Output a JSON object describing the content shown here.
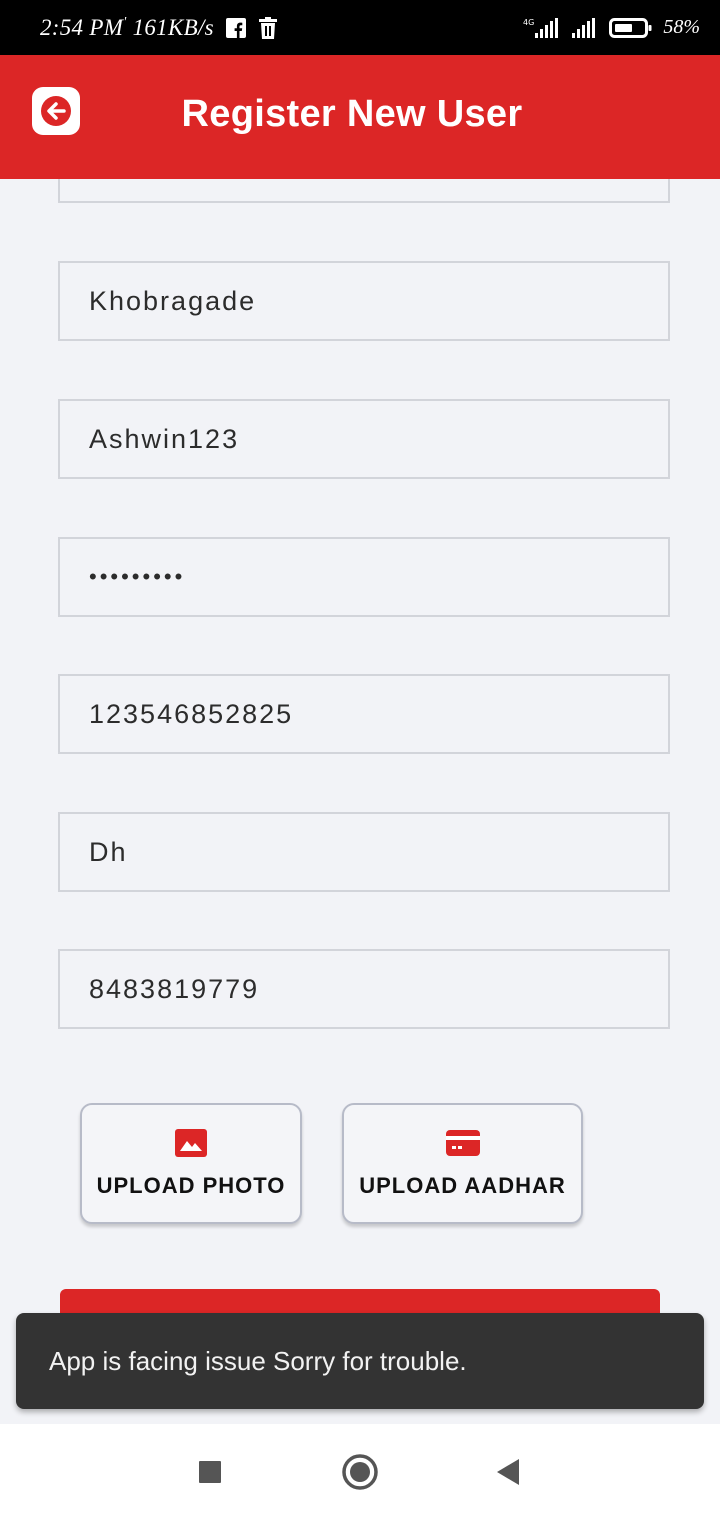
{
  "status_bar": {
    "time": "2:54 PM",
    "network_speed": "161KB/s",
    "network_type": "4G",
    "battery": "58%",
    "icons": [
      "facebook-icon",
      "delete-icon",
      "signal-icon",
      "battery-icon"
    ]
  },
  "app_bar": {
    "title": "Register New User",
    "back_icon": "arrow-left-icon",
    "color": "#dc2626"
  },
  "form": {
    "fields": [
      {
        "value": ""
      },
      {
        "value": "Khobragade"
      },
      {
        "value": "Ashwin123"
      },
      {
        "value": "•••••••••",
        "type": "password"
      },
      {
        "value": "123546852825"
      },
      {
        "value": "Dh"
      },
      {
        "value": "8483819779"
      }
    ],
    "upload_photo": {
      "label": "UPLOAD PHOTO",
      "icon": "image-icon"
    },
    "upload_aadhar": {
      "label": "UPLOAD AADHAR",
      "icon": "id-card-icon"
    }
  },
  "snackbar": {
    "message": "App is facing issue Sorry for trouble."
  },
  "nav_bar": {
    "icons": [
      "recents-icon",
      "home-icon",
      "back-icon"
    ]
  }
}
